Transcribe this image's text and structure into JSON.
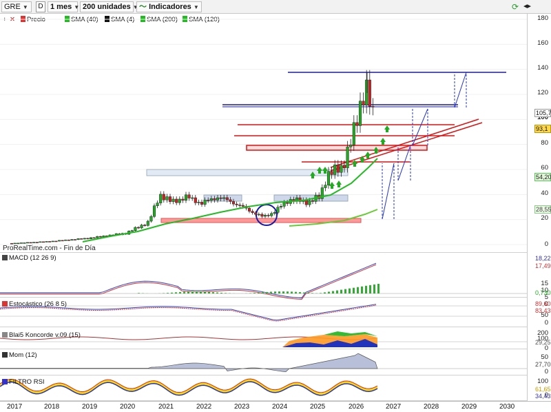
{
  "toolbar": {
    "ticker": "GRE",
    "d_label": "D",
    "period": "1 mes",
    "units": "200 unidades",
    "indicators": "Indicadores"
  },
  "legend": {
    "price": "Precio",
    "sma40": "SMA (40)",
    "sma4": "SMA (4)",
    "sma200": "SMA (200)",
    "sma120": "SMA (120)"
  },
  "brand": "ProRealTime.com - Fin de Día",
  "panels": {
    "macd": "MACD (12 26 9)",
    "stoch": "Estocástico (26 8 5)",
    "blai5": "Blai5 Koncorde v.09 (15)",
    "mom": "Mom (12)",
    "rsi": "FILTRO RSI"
  },
  "price_axis": [
    "180",
    "160",
    "140",
    "120",
    "100",
    "80",
    "60",
    "40",
    "20",
    "0"
  ],
  "price_tags": {
    "high": "105,7",
    "last": "93,1",
    "sma40": "54,20",
    "sma120": "28,55"
  },
  "macd_axis": [
    "15",
    "10",
    "5",
    "0"
  ],
  "macd_tags": [
    "18,22",
    "17,49",
    "0,730"
  ],
  "stoch_axis": [
    "50",
    "0"
  ],
  "stoch_tags": [
    "89,60",
    "83,43"
  ],
  "blai_axis": [
    "200",
    "100",
    "0"
  ],
  "blai_tags": [
    "29,25"
  ],
  "mom_axis": [
    "50",
    "0"
  ],
  "mom_tags": [
    "27,70"
  ],
  "rsi_axis": [
    "100",
    "0"
  ],
  "rsi_tags": [
    "61,65",
    "34,43"
  ],
  "years": [
    "2017",
    "2018",
    "2019",
    "2020",
    "2021",
    "2022",
    "2023",
    "2024",
    "2025",
    "2026",
    "2027",
    "2028",
    "2029",
    "2030"
  ],
  "colors": {
    "sma40": "#22bb22",
    "sma120": "#66cc33",
    "candle_up": "#22aa22",
    "candle_down": "#cc2222",
    "blue_line": "#1a1aaa",
    "red_line": "#dd1111",
    "highlight": "#ff9999"
  },
  "chart_data": {
    "type": "line",
    "title": "",
    "x": [
      "2017",
      "2018",
      "2019",
      "2020",
      "2021",
      "2022",
      "2023",
      "2024",
      "2025",
      "2026"
    ],
    "series": [
      {
        "name": "Precio",
        "values": [
          3,
          5,
          8,
          15,
          38,
          35,
          32,
          30,
          48,
          93.1
        ]
      },
      {
        "name": "SMA (40)",
        "values": [
          2,
          3,
          5,
          12,
          18,
          22,
          26,
          30,
          36,
          54.2
        ]
      },
      {
        "name": "SMA (120)",
        "values": [
          null,
          null,
          null,
          null,
          null,
          null,
          null,
          22,
          24,
          28.55
        ]
      }
    ],
    "ylim": [
      0,
      180
    ]
  }
}
